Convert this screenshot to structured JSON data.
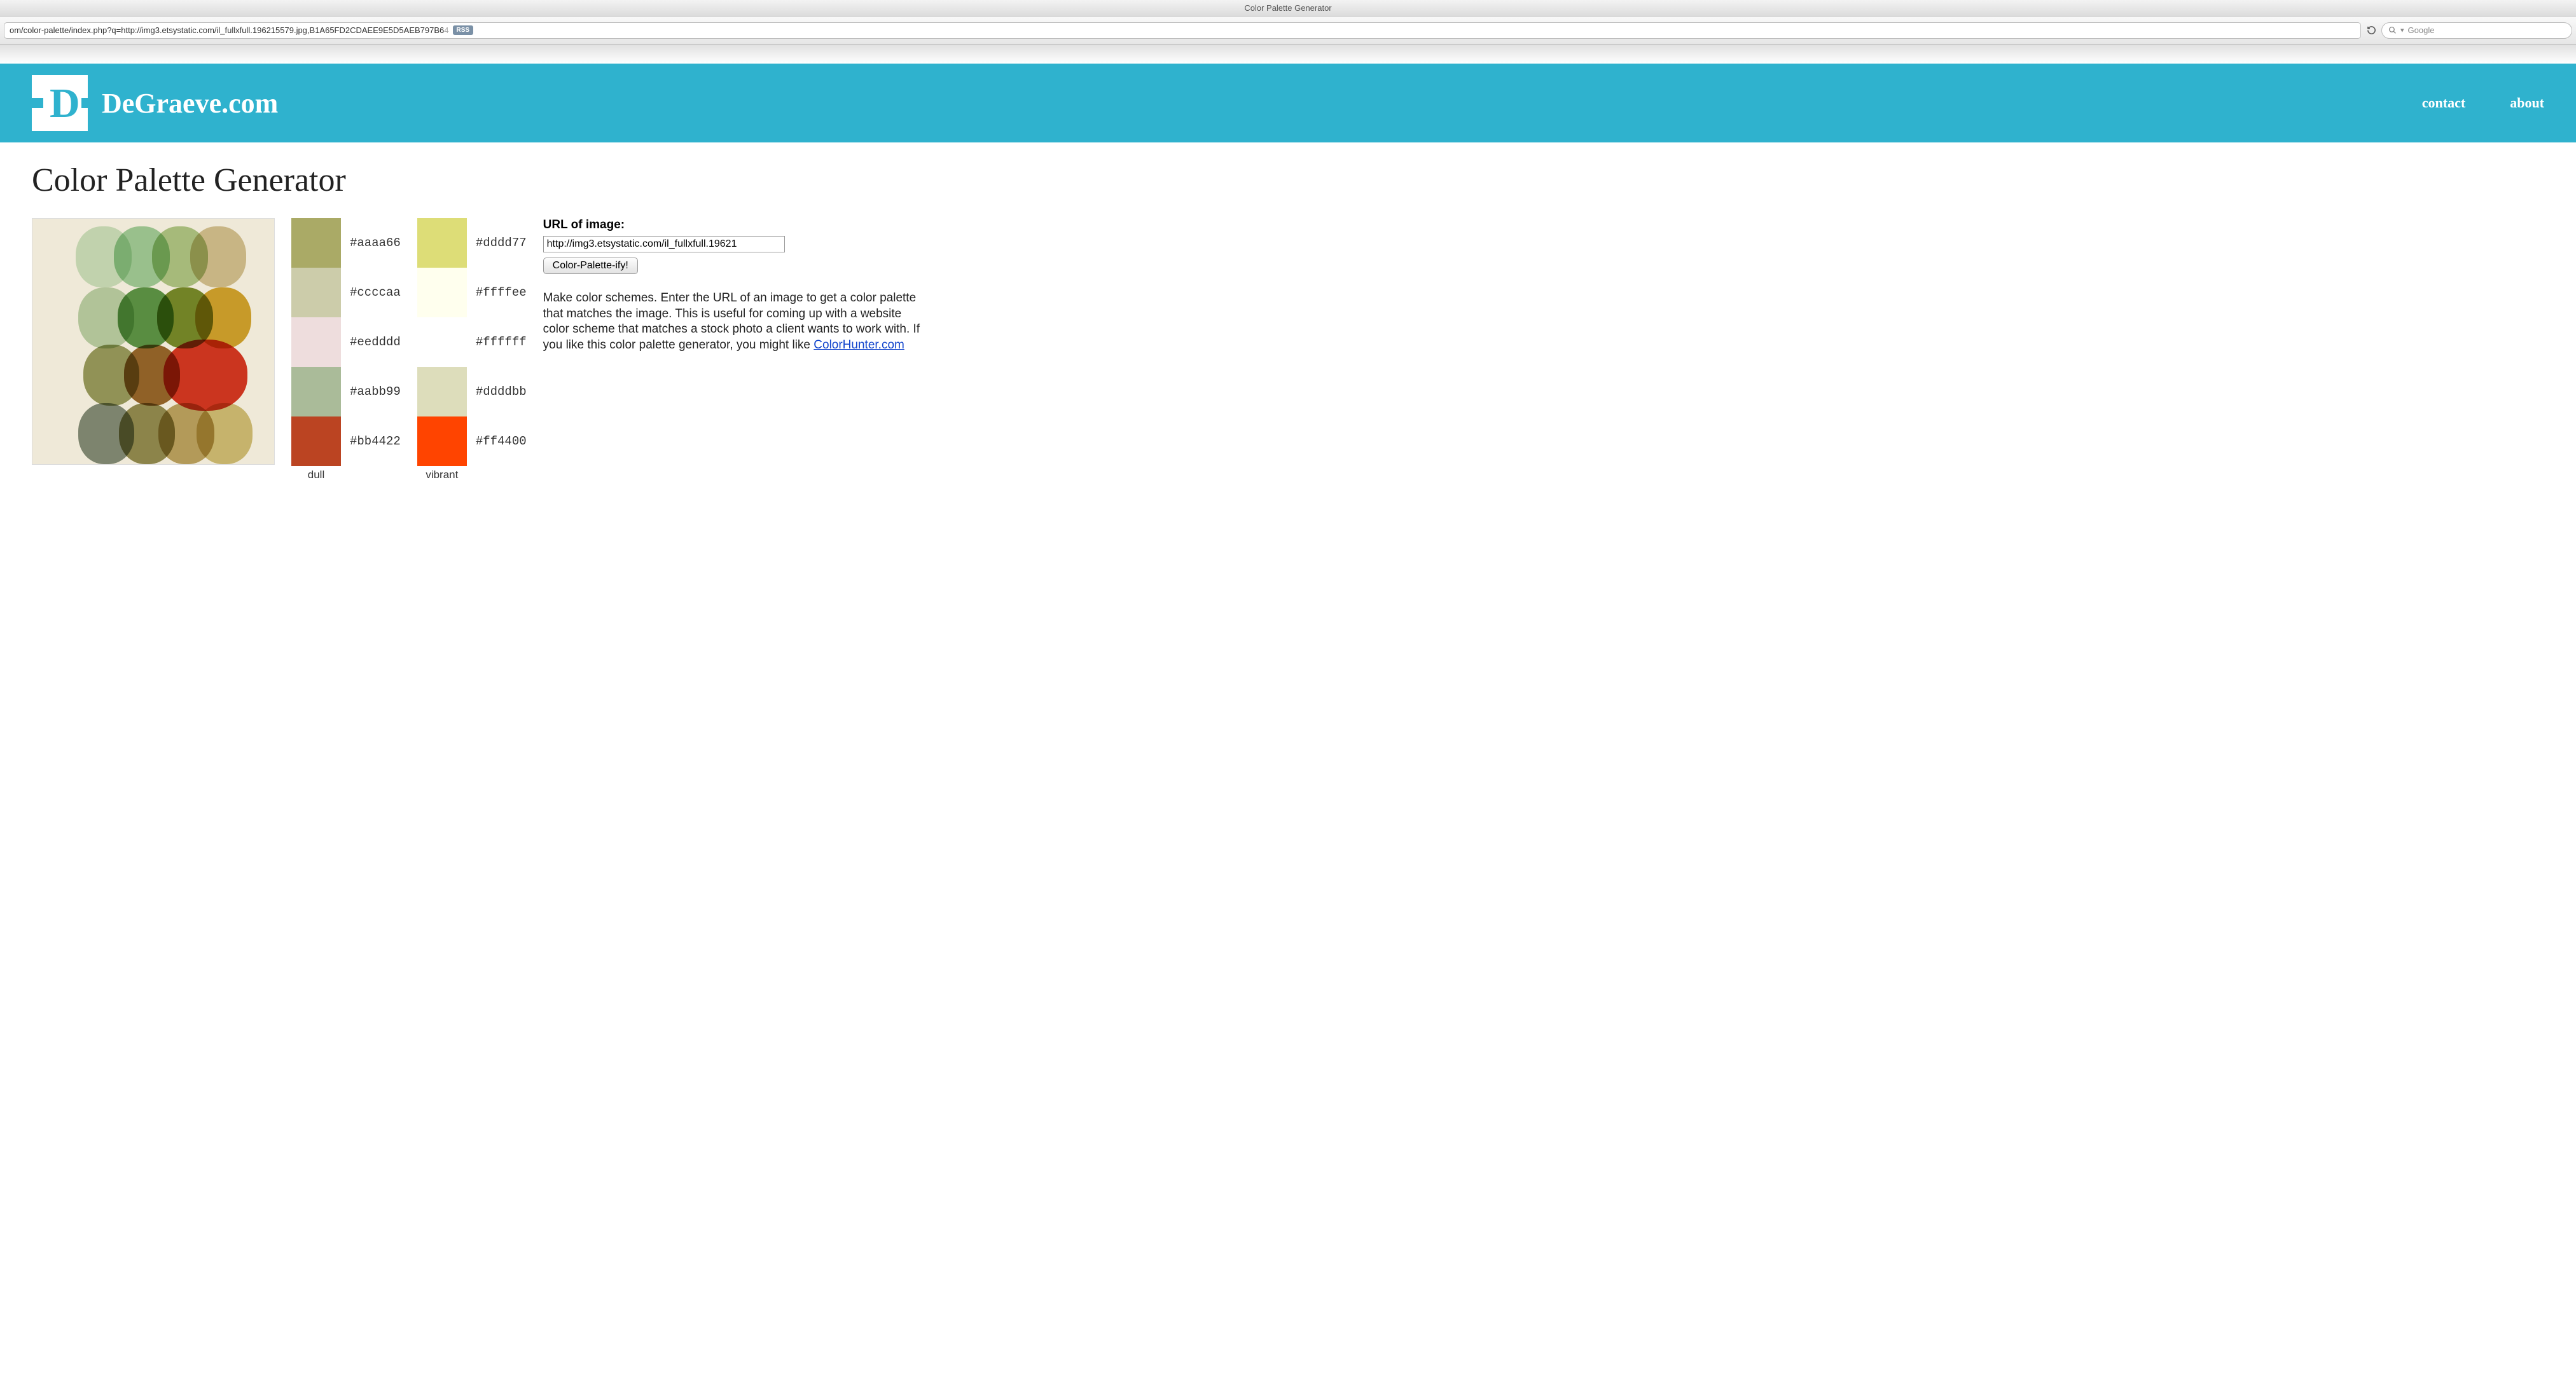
{
  "window": {
    "title": "Color Palette Generator",
    "url_visible": "om/color-palette/index.php?q=http://img3.etsystatic.com/il_fullxfull.196215579.jpg,B1A65FD2CDAEE9E5D5AEB797B6",
    "url_dimmed_tail": "4",
    "rss_label": "RSS",
    "search_placeholder": "Google"
  },
  "site": {
    "brand": "DeGraeve.com",
    "nav": {
      "contact": "contact",
      "about": "about"
    }
  },
  "page": {
    "heading": "Color Palette Generator",
    "dull_label": "dull",
    "vibrant_label": "vibrant",
    "dull_palette": [
      {
        "hex": "#aaaa66"
      },
      {
        "hex": "#ccccaa"
      },
      {
        "hex": "#eedddd"
      },
      {
        "hex": "#aabb99"
      },
      {
        "hex": "#bb4422"
      }
    ],
    "vibrant_palette": [
      {
        "hex": "#dddd77"
      },
      {
        "hex": "#ffffee"
      },
      {
        "hex": "#ffffff"
      },
      {
        "hex": "#ddddbb"
      },
      {
        "hex": "#ff4400"
      }
    ],
    "form": {
      "label": "URL of image:",
      "value": "http://img3.etsystatic.com/il_fullxfull.19621",
      "button": "Color-Palette-ify!"
    },
    "description_text": "Make color schemes. Enter the URL of an image to get a color palette that matches the image. This is useful for coming up with a website color scheme that matches a stock photo a client wants to work with. If you like this color palette generator, you might like ",
    "description_link": "ColorHunter.com"
  }
}
